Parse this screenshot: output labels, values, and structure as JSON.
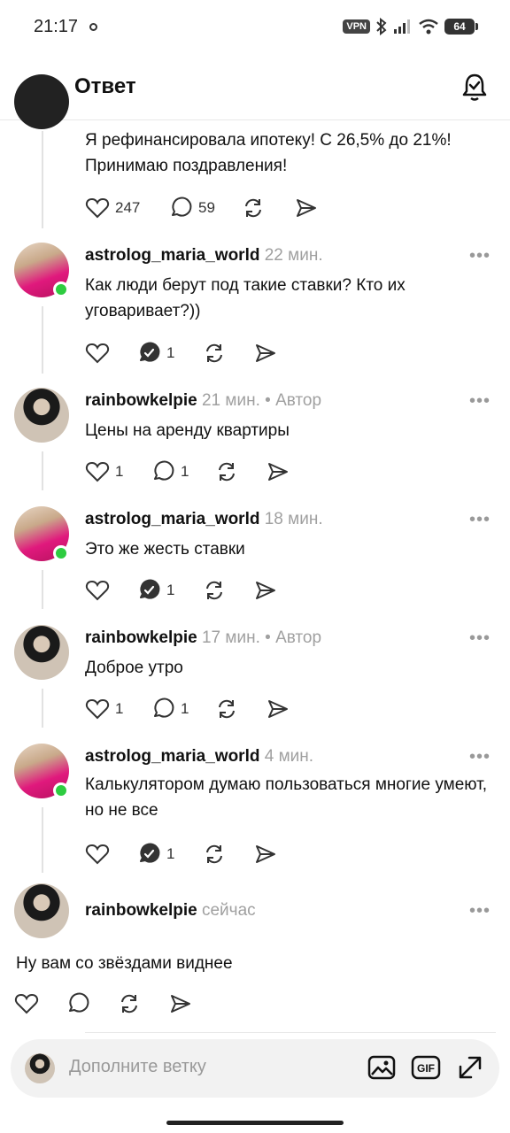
{
  "status_bar": {
    "time": "21:17",
    "vpn": "VPN",
    "battery": "64"
  },
  "header": {
    "title": "Ответ"
  },
  "top_post": {
    "text": "Я рефинансировала ипотеку! С 26,5% до 21%! Принимаю поздравления!",
    "likes": "247",
    "replies": "59"
  },
  "posts": [
    {
      "user": "astrolog_maria_world",
      "time": "22 мин.",
      "badge": "",
      "text": "Как люди берут под такие ставки? Кто их уговаривает?))",
      "likes": "",
      "replies": "1"
    },
    {
      "user": "rainbowkelpie",
      "time": "21 мин.",
      "badge": "• Автор",
      "text": "Цены на аренду квартиры",
      "likes": "1",
      "replies": "1"
    },
    {
      "user": "astrolog_maria_world",
      "time": "18 мин.",
      "badge": "",
      "text": "Это же жесть ставки",
      "likes": "",
      "replies": "1"
    },
    {
      "user": "rainbowkelpie",
      "time": "17 мин.",
      "badge": "• Автор",
      "text": "Доброе утро",
      "likes": "1",
      "replies": "1"
    },
    {
      "user": "astrolog_maria_world",
      "time": "4 мин.",
      "badge": "",
      "text": "Калькулятором думаю пользоваться многие умеют, но не все",
      "likes": "",
      "replies": "1"
    },
    {
      "user": "rainbowkelpie",
      "time": "сейчас",
      "badge": "",
      "text": "Ну вам со звёздами виднее",
      "likes": "",
      "replies": ""
    }
  ],
  "more_glyph": "•••",
  "composer": {
    "placeholder": "Дополните ветку"
  },
  "colors": {
    "online": "#2ecc40",
    "pink": "#e0197d",
    "meta": "#a0a0a0"
  }
}
